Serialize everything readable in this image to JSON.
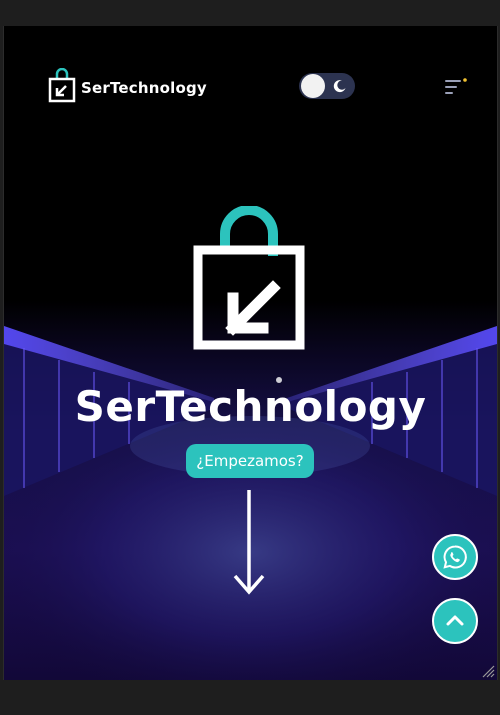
{
  "header": {
    "brand_name": "SerTechnology"
  },
  "hero": {
    "title": "SerTechnology",
    "cta_label": "¿Empezamos?"
  },
  "icons": {
    "whatsapp": "whatsapp-icon",
    "scroll_top": "chevron-up-icon",
    "scroll_down": "arrow-down-icon",
    "menu": "menu-icon",
    "theme": "moon-icon"
  },
  "colors": {
    "accent": "#2cc3bd",
    "toggle_track": "#2c3350",
    "menu_dot": "#f2c230",
    "text": "#ffffff",
    "background": "#000000"
  }
}
